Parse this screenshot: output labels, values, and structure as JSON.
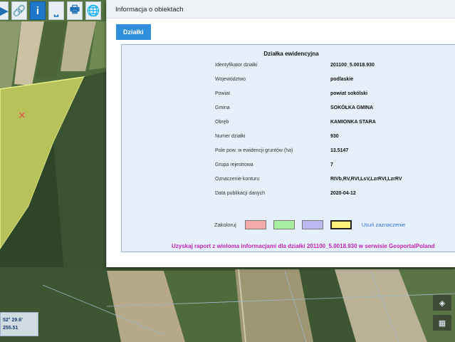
{
  "toolbar": {
    "tools": [
      {
        "icon": "arrow-right-icon",
        "glyph": "▶",
        "active": false
      },
      {
        "icon": "link-icon",
        "glyph": "🔗",
        "active": false
      },
      {
        "icon": "info-icon",
        "glyph": "i",
        "active": true
      },
      {
        "icon": "ruler-icon",
        "glyph": "⎵",
        "active": false
      },
      {
        "icon": "print-icon",
        "glyph": "🖶",
        "active": false
      },
      {
        "icon": "globe-icon",
        "glyph": "🌐",
        "active": false
      }
    ]
  },
  "coords": {
    "line1": "52° 29.6'",
    "line2": "255.51"
  },
  "panel": {
    "title": "Informacja o obiektach",
    "tab_label": "Działki",
    "card_title": "Działka ewidencyjna",
    "rows": [
      {
        "label": "Identyfikator działki",
        "value": "201100_5.0018.930"
      },
      {
        "label": "Województwo",
        "value": "podlaskie"
      },
      {
        "label": "Powiat",
        "value": "powiat sokólski"
      },
      {
        "label": "Gmina",
        "value": "SOKÓŁKA GMINA"
      },
      {
        "label": "Obręb",
        "value": "KAMIONKA STARA"
      },
      {
        "label": "Numer działki",
        "value": "930"
      },
      {
        "label": "Pole pow. w ewidencji gruntów (ha)",
        "value": "13.5147"
      },
      {
        "label": "Grupa rejestrowa",
        "value": "7"
      },
      {
        "label": "Oznaczenie konturu",
        "value": "RIVb,RV,RVI,LsV,LzrRVI,LzrRV"
      },
      {
        "label": "Data publikacji danych",
        "value": "2020-04-12"
      }
    ],
    "highlight_label": "Zakoloruj",
    "swatches": [
      "#f4a9a9",
      "#a8eea0",
      "#bcb8f2",
      "#fff27a"
    ],
    "clear_label": "Usuń zaznaczenie",
    "report_link": "Uzyskaj raport z wieloma informacjami dla działki 201100_5.0018.930 w serwisie GeoportalPoland"
  }
}
